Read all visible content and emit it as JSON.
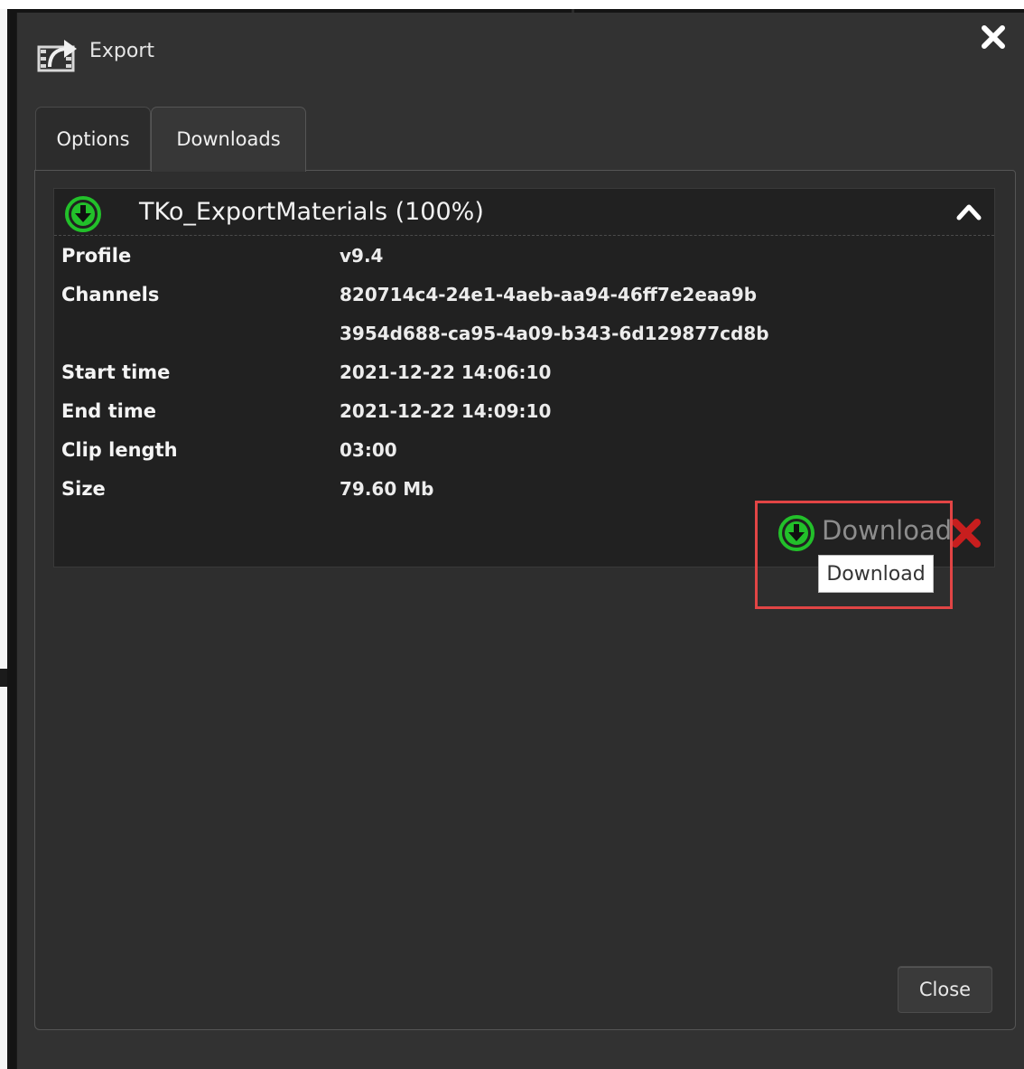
{
  "dialog": {
    "title": "Export",
    "title_icon": "export-icon",
    "close_icon": "close-icon"
  },
  "tabs": [
    {
      "label": "Options",
      "active": false
    },
    {
      "label": "Downloads",
      "active": true
    }
  ],
  "download_item": {
    "title": "TKo_ExportMaterials (100%)",
    "status_icon": "download-arrow-icon",
    "collapse_icon": "chevron-up-icon",
    "fields": [
      {
        "label": "Profile",
        "value": "v9.4"
      },
      {
        "label": "Channels",
        "value": "820714c4-24e1-4aeb-aa94-46ff7e2eaa9b"
      },
      {
        "label": "",
        "value": "3954d688-ca95-4a09-b343-6d129877cd8b"
      },
      {
        "label": "Start time",
        "value": "2021-12-22 14:06:10"
      },
      {
        "label": "End time",
        "value": "2021-12-22 14:09:10"
      },
      {
        "label": "Clip length",
        "value": "03:00"
      },
      {
        "label": "Size",
        "value": "79.60 Mb"
      }
    ],
    "download_label": "Download",
    "tooltip": "Download",
    "delete_icon": "delete-x-icon"
  },
  "footer": {
    "close_label": "Close"
  },
  "colors": {
    "accent_green": "#22c02a",
    "delete_red": "#c81e1e",
    "highlight_red": "#e24545"
  }
}
